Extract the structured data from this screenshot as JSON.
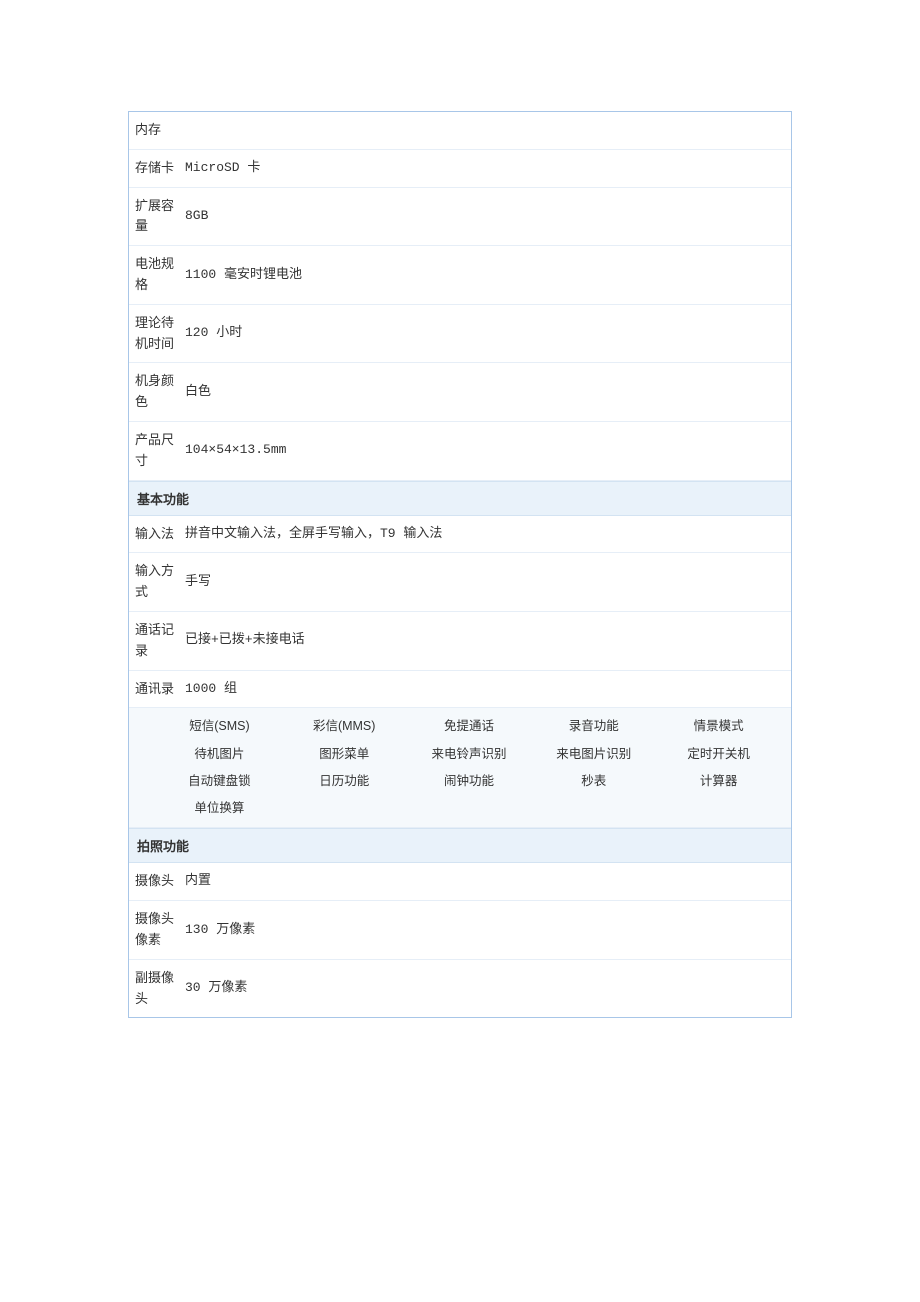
{
  "specs_top": [
    {
      "label": "内存",
      "value": ""
    },
    {
      "label": "存储卡",
      "value": "MicroSD 卡"
    },
    {
      "label": "扩展容量",
      "value": "8GB"
    },
    {
      "label": "电池规格",
      "value": "1100 毫安时锂电池"
    },
    {
      "label": "理论待机时间",
      "value": "120 小时"
    },
    {
      "label": "机身颜色",
      "value": "白色"
    },
    {
      "label": "产品尺寸",
      "value": "104×54×13.5mm"
    }
  ],
  "section_basic": {
    "title": "基本功能",
    "rows": [
      {
        "label": "输入法",
        "value": "拼音中文输入法，全屏手写输入，T9 输入法"
      },
      {
        "label": "输入方式",
        "value": "手写"
      },
      {
        "label": "通话记录",
        "value": "已接+已拨+未接电话"
      },
      {
        "label": "通讯录",
        "value": "1000 组"
      }
    ],
    "features": [
      "短信(SMS)",
      "彩信(MMS)",
      "免提通话",
      "录音功能",
      "情景模式",
      "待机图片",
      "图形菜单",
      "来电铃声识别",
      "来电图片识别",
      "定时开关机",
      "自动键盘锁",
      "日历功能",
      "闹钟功能",
      "秒表",
      "计算器",
      "单位换算"
    ]
  },
  "section_camera": {
    "title": "拍照功能",
    "rows": [
      {
        "label": "摄像头",
        "value": "内置"
      },
      {
        "label": "摄像头像素",
        "value": "130 万像素"
      },
      {
        "label": "副摄像头",
        "value": "30 万像素"
      }
    ]
  }
}
